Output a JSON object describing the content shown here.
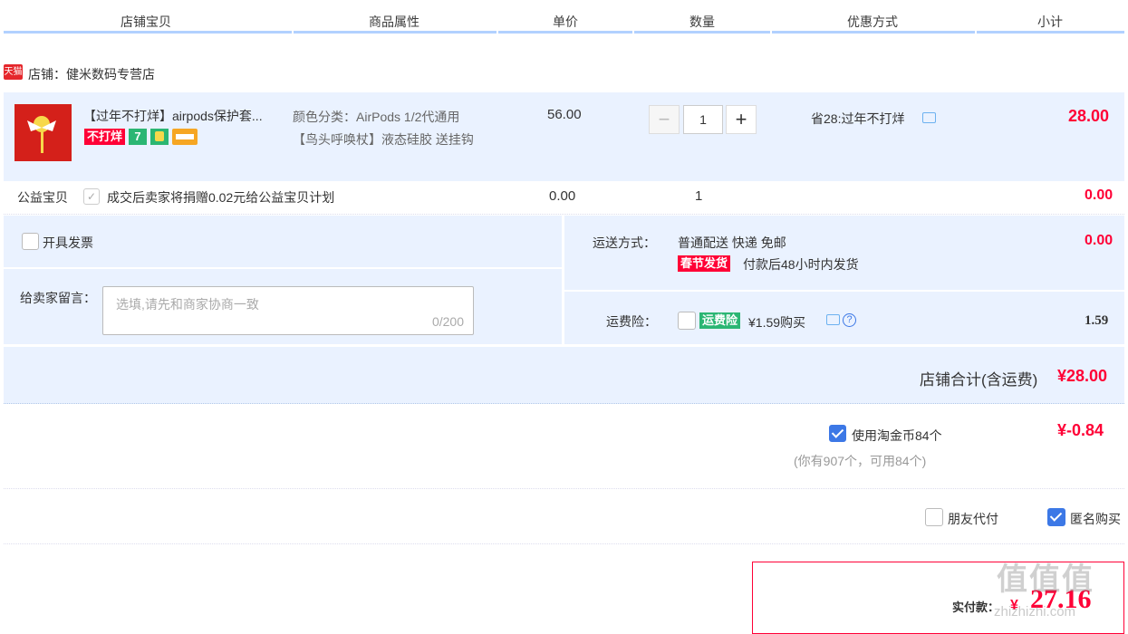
{
  "header": {
    "shop_item": "店铺宝贝",
    "attributes": "商品属性",
    "unit_price": "单价",
    "quantity": "数量",
    "discount": "优惠方式",
    "subtotal": "小计"
  },
  "shop": {
    "badge": "天猫",
    "label": "店铺：健米数码专营店"
  },
  "item": {
    "title": "【过年不打烊】airpods保护套...",
    "tag_no_close": "不打烊",
    "tag_seven": "7",
    "attr_color": "颜色分类：AirPods 1/2代通用",
    "attr_extra": "【鸟头呼唤杖】液态硅胶 送挂钩",
    "unit_price": "56.00",
    "quantity": "1",
    "discount_text": "省28:过年不打烊",
    "subtotal": "28.00"
  },
  "charity": {
    "label": "公益宝贝",
    "text": "成交后卖家将捐赠0.02元给公益宝贝计划",
    "price": "0.00",
    "quantity": "1",
    "subtotal": "0.00"
  },
  "invoice": {
    "label": "开具发票"
  },
  "message": {
    "label": "给卖家留言：",
    "placeholder": "选填,请先和商家协商一致",
    "counter": "0/200"
  },
  "shipping": {
    "label": "运送方式：",
    "method": "普通配送 快递 免邮",
    "tag": "春节发货",
    "note": "付款后48小时内发货",
    "fee": "0.00"
  },
  "insurance": {
    "label": "运费险：",
    "tag": "运费险",
    "price_text": "¥1.59购买",
    "fee": "1.59"
  },
  "shop_total": {
    "label": "店铺合计(含运费)",
    "value": "¥28.00"
  },
  "coins": {
    "label": "使用淘金币84个",
    "value": "¥-0.84",
    "note": "(你有907个，可用84个)"
  },
  "options": {
    "friend_pay": "朋友代付",
    "anonymous": "匿名购买"
  },
  "payment": {
    "label": "实付款：",
    "currency": "¥",
    "value": "27.16"
  },
  "watermark": {
    "logo": "值值值",
    "site": "zhizhizhi.com"
  },
  "colors": {
    "accent_red": "#ff0036",
    "header_line": "#b2d1ff",
    "block_bg": "#eaf2ff",
    "checkbox_blue": "#3c78e6"
  }
}
